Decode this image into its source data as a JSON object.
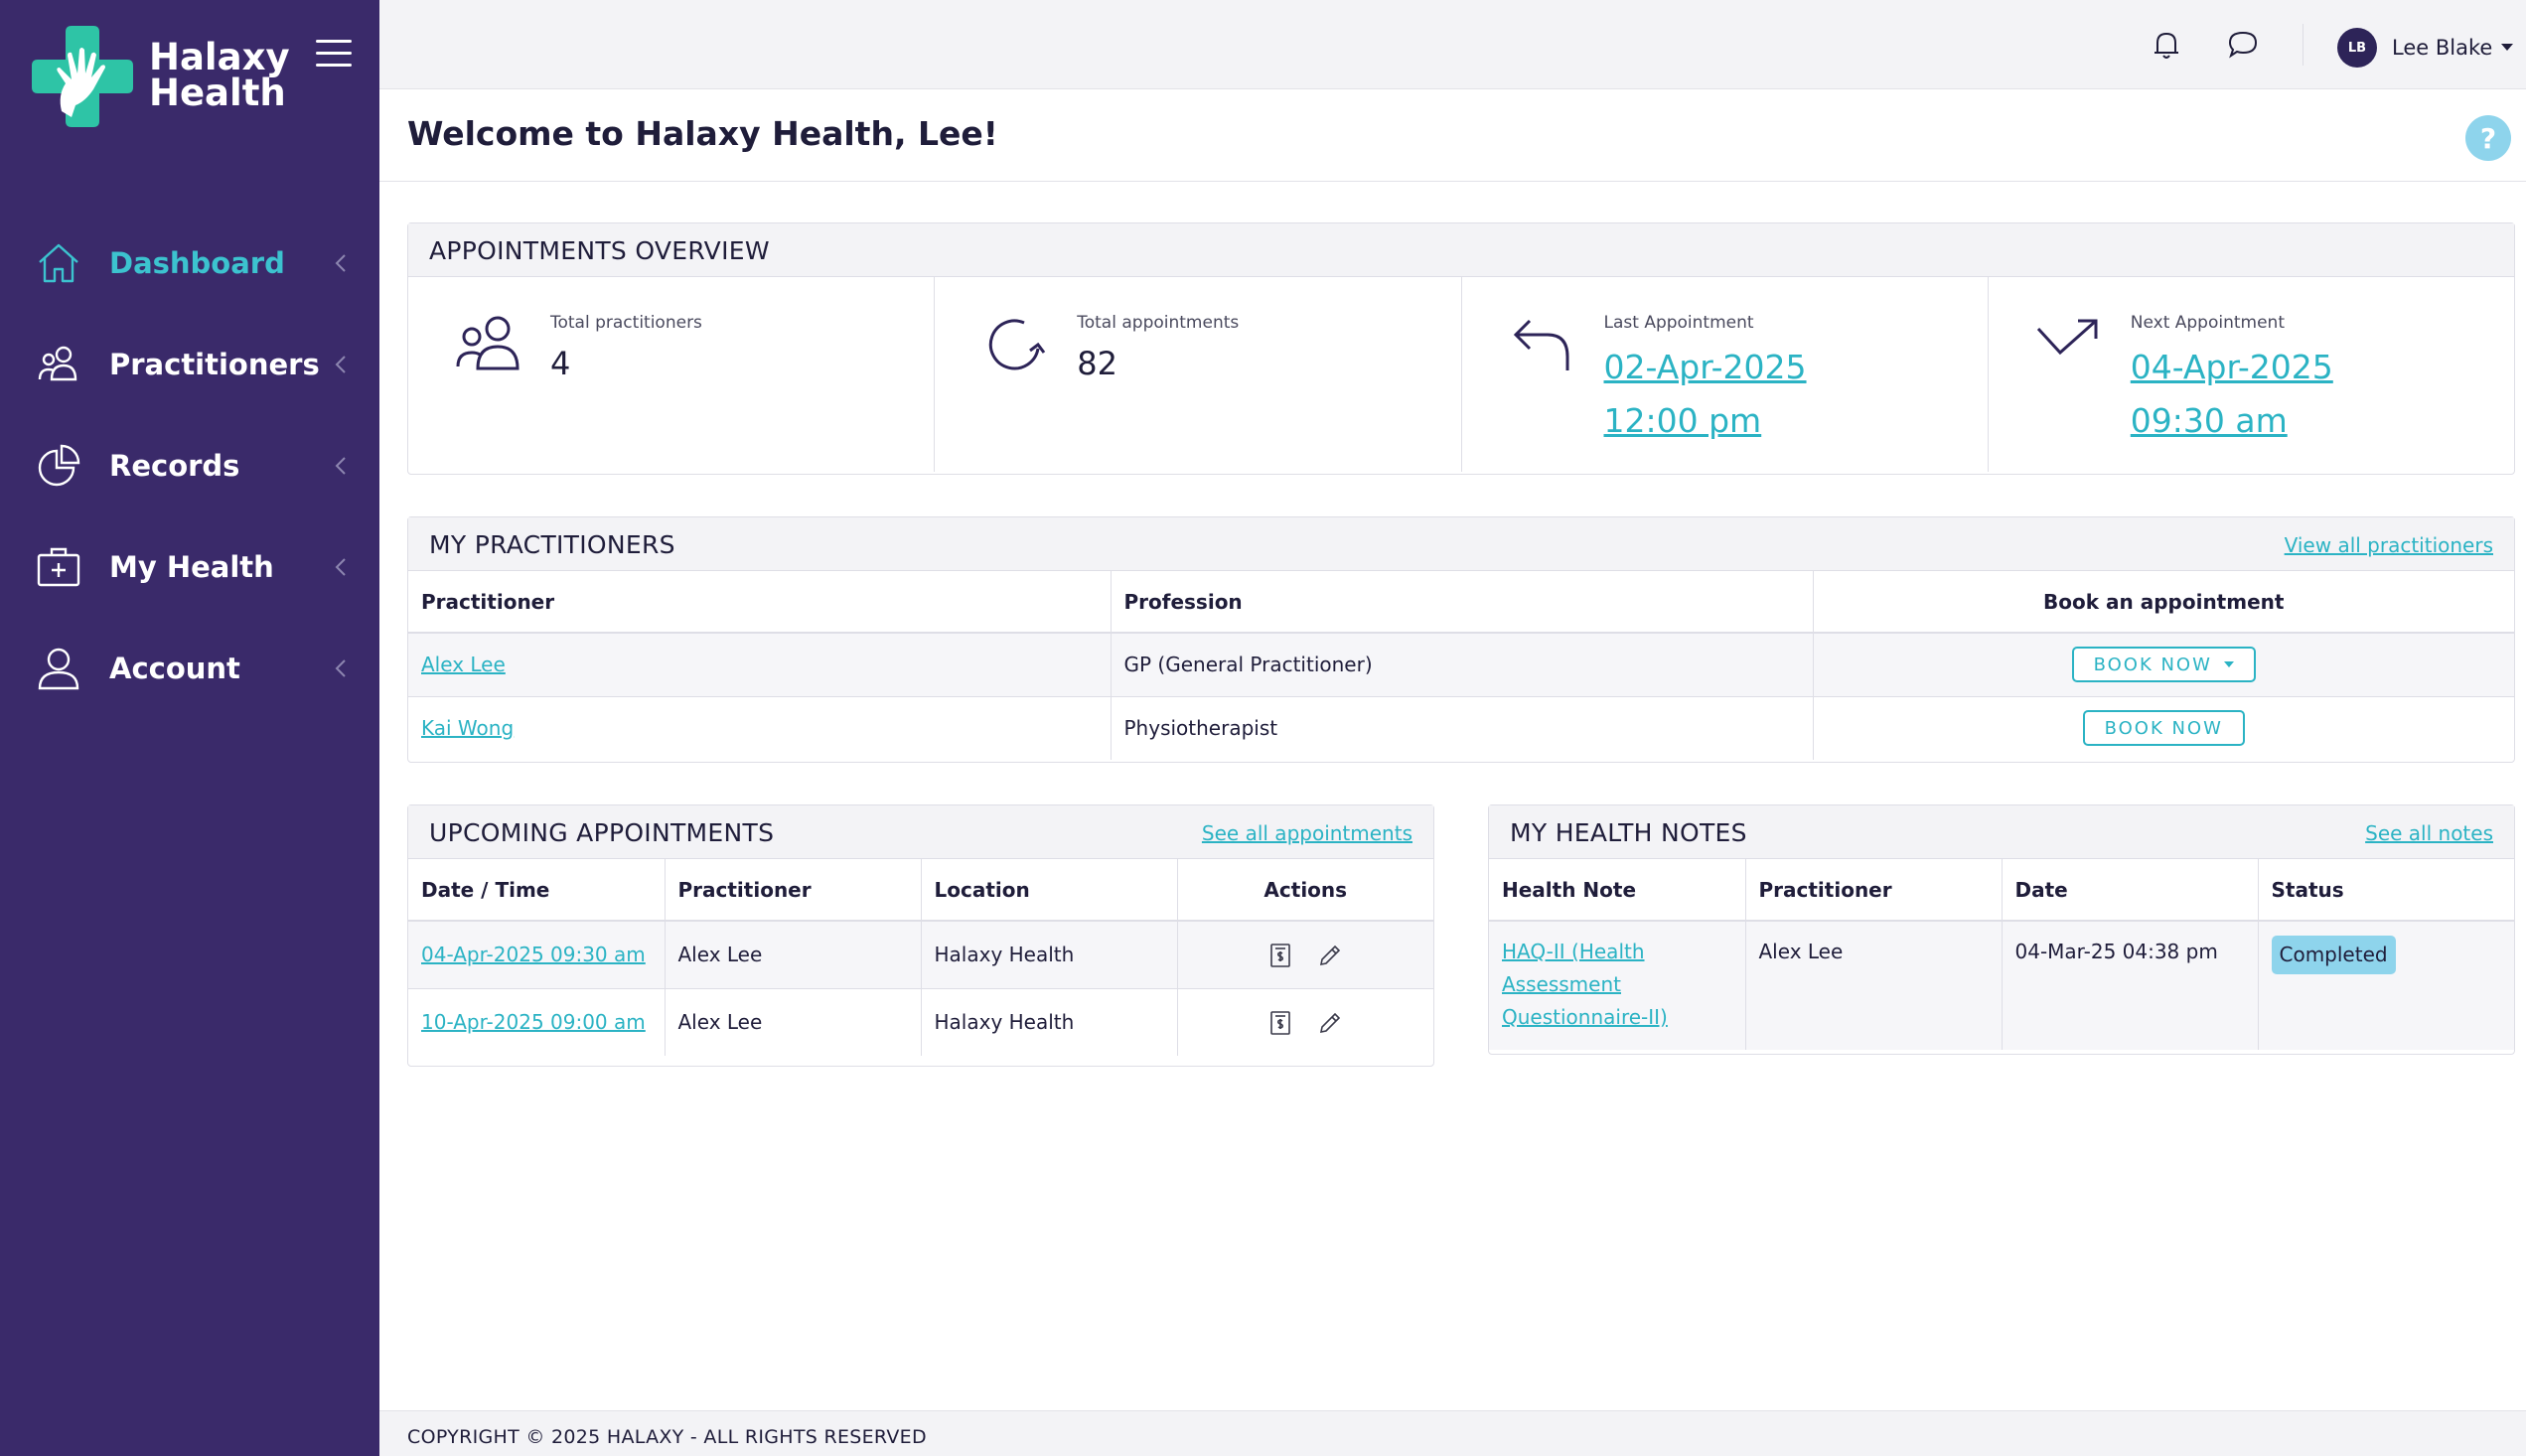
{
  "brand": {
    "name_line1": "Halaxy",
    "name_line2": "Health",
    "colors": {
      "sidebar": "#3a2a6a",
      "accent": "#2bb3c4",
      "logo_green": "#2ec4a6"
    }
  },
  "sidebar": {
    "items": [
      {
        "label": "Dashboard",
        "icon": "home-icon",
        "active": true
      },
      {
        "label": "Practitioners",
        "icon": "users-icon"
      },
      {
        "label": "Records",
        "icon": "pie-chart-icon"
      },
      {
        "label": "My Health",
        "icon": "medical-kit-icon"
      },
      {
        "label": "Account",
        "icon": "user-icon"
      }
    ]
  },
  "topbar": {
    "user_initials": "LB",
    "user_name": "Lee Blake"
  },
  "page": {
    "title": "Welcome to Halaxy Health, Lee!",
    "help": "?"
  },
  "overview": {
    "title": "APPOINTMENTS OVERVIEW",
    "cards": [
      {
        "label": "Total practitioners",
        "value": "4"
      },
      {
        "label": "Total appointments",
        "value": "82"
      },
      {
        "label": "Last Appointment",
        "date": "02-Apr-2025",
        "time": "12:00 pm"
      },
      {
        "label": "Next Appointment",
        "date": "04-Apr-2025",
        "time": "09:30 am"
      }
    ]
  },
  "practitioners": {
    "title": "MY PRACTITIONERS",
    "link": "View all practitioners",
    "headers": [
      "Practitioner",
      "Profession",
      "Book an appointment"
    ],
    "rows": [
      {
        "name": "Alex Lee",
        "profession": "GP (General Practitioner)",
        "button": "BOOK NOW"
      },
      {
        "name": "Kai Wong",
        "profession": "Physiotherapist",
        "button": "BOOK NOW"
      }
    ]
  },
  "upcoming": {
    "title": "UPCOMING APPOINTMENTS",
    "link": "See all appointments",
    "headers": [
      "Date / Time",
      "Practitioner",
      "Location",
      "Actions"
    ],
    "rows": [
      {
        "datetime": "04-Apr-2025 09:30 am",
        "practitioner": "Alex Lee",
        "location": "Halaxy Health"
      },
      {
        "datetime": "10-Apr-2025 09:00 am",
        "practitioner": "Alex Lee",
        "location": "Halaxy Health"
      }
    ]
  },
  "notes": {
    "title": "MY HEALTH NOTES",
    "link": "See all notes",
    "headers": [
      "Health Note",
      "Practitioner",
      "Date",
      "Status"
    ],
    "rows": [
      {
        "note_line1": "HAQ-II (Health",
        "note_line2": "Assessment",
        "note_line3": "Questionnaire-II)",
        "practitioner": "Alex Lee",
        "date": "04-Mar-25 04:38 pm",
        "status": "Completed"
      }
    ]
  },
  "footer": {
    "copyright": "COPYRIGHT © 2025 HALAXY - ALL RIGHTS RESERVED"
  }
}
